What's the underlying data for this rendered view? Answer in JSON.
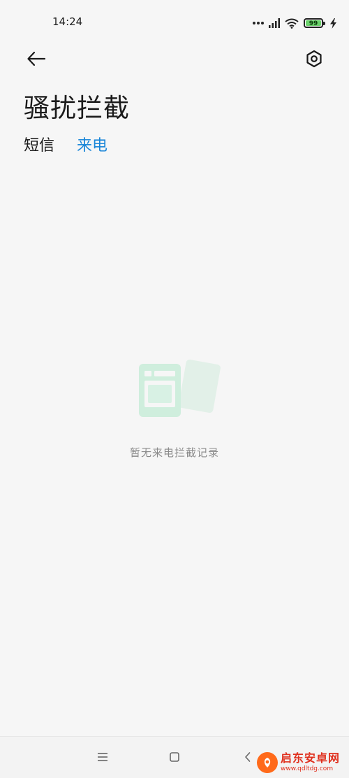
{
  "status_bar": {
    "time": "14:24",
    "battery": "99",
    "icons": [
      "dots-icon",
      "signal-icon",
      "wifi-icon",
      "battery-icon",
      "charging-bolt-icon"
    ]
  },
  "header": {
    "back_icon": "arrow-left-icon",
    "settings_icon": "gear-hexagon-icon"
  },
  "page": {
    "title": "骚扰拦截"
  },
  "tabs": [
    {
      "label": "短信",
      "active": false
    },
    {
      "label": "来电",
      "active": true
    }
  ],
  "empty_state": {
    "message": "暂无来电拦截记录",
    "icon": "empty-records-illustration"
  },
  "nav_bar": {
    "items": [
      "menu-icon",
      "home-square-icon",
      "back-chevron-icon"
    ]
  },
  "watermark": {
    "title": "启东安卓网",
    "url": "www.qdltdg.com"
  },
  "colors": {
    "accent": "#1a86d8",
    "background": "#f6f6f6",
    "battery_fill": "#6bd36b",
    "illustration": "#cfeedd",
    "watermark": "#e0301e"
  }
}
